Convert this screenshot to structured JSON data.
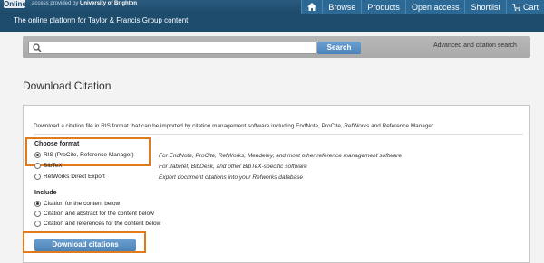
{
  "header": {
    "logo_text": "Online",
    "access_prefix": "access provided by",
    "access_org": "University of Brighton",
    "tagline": "The online platform for Taylor & Francis Group content",
    "nav": [
      {
        "label": "Browse",
        "icon": "none"
      },
      {
        "label": "Products",
        "icon": "none"
      },
      {
        "label": "Open access",
        "icon": "none"
      },
      {
        "label": "Shortlist",
        "icon": "none"
      },
      {
        "label": "Cart",
        "icon": "cart-icon"
      }
    ]
  },
  "search": {
    "placeholder": "",
    "button_label": "Search",
    "advanced_link": "Advanced and citation search"
  },
  "page": {
    "title": "Download Citation",
    "description": "Download a citation file in RIS format that can be imported by citation management software including EndNote, ProCite, RefWorks and Reference Manager."
  },
  "format": {
    "label": "Choose format",
    "options": [
      {
        "label": "RIS (ProCite, Reference Manager)",
        "help": "For EndNote, ProCite, RefWorks, Mendeley, and most other reference management software",
        "selected": true
      },
      {
        "label": "BibTeX",
        "help": "For JabRef, BibDesk, and other BibTeX-specific software",
        "selected": false
      },
      {
        "label": "RefWorks Direct Export",
        "help": "Export document citations into your Refworks database",
        "selected": false
      }
    ]
  },
  "include": {
    "label": "Include",
    "options": [
      {
        "label": "Citation for the content below",
        "selected": true
      },
      {
        "label": "Citation and abstract for the content below",
        "selected": false
      },
      {
        "label": "Citation and references for the content below",
        "selected": false
      }
    ]
  },
  "actions": {
    "download_label": "Download citations"
  },
  "colors": {
    "highlight": "#e07a1a",
    "button": "#4c83b8",
    "header": "#1e4c6d"
  }
}
